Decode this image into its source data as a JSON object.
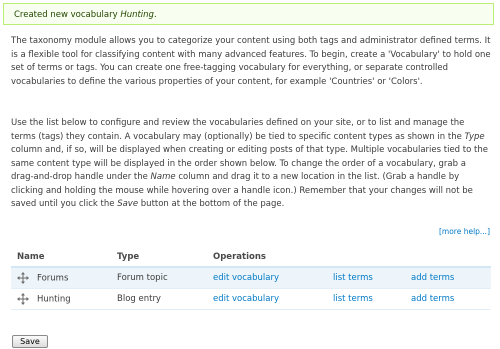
{
  "status_message": {
    "prefix": "Created new vocabulary ",
    "name": "Hunting",
    "suffix": "."
  },
  "help": {
    "paragraph1": "The taxonomy module allows you to categorize your content using both tags and administrator defined terms. It is a flexible tool for classifying content with many advanced features. To begin, create a 'Vocabulary' to hold one set of terms or tags. You can create one free-tagging vocabulary for everything, or separate controlled vocabularies to define the various properties of your content, for example 'Countries' or 'Colors'.",
    "p2_a": "Use the list below to configure and review the vocabularies defined on your site, or to list and manage the terms (tags) they contain. A vocabulary may (optionally) be tied to specific content types as shown in the ",
    "p2_type": "Type",
    "p2_b": " column and, if so, will be displayed when creating or editing posts of that type. Multiple vocabularies tied to the same content type will be displayed in the order shown below. To change the order of a vocabulary, grab a drag-and-drop handle under the ",
    "p2_name": "Name",
    "p2_c": " column and drag it to a new location in the list. (Grab a handle by clicking and holding the mouse while hovering over a handle icon.) Remember that your changes will not be saved until you click the ",
    "p2_save": "Save",
    "p2_d": " button at the bottom of the page.",
    "more_help": "[more help...]"
  },
  "table": {
    "headers": {
      "name": "Name",
      "type": "Type",
      "operations": "Operations"
    },
    "rows": [
      {
        "name": "Forums",
        "type": "Forum topic",
        "edit": "edit vocabulary",
        "list": "list terms",
        "add": "add terms"
      },
      {
        "name": "Hunting",
        "type": "Blog entry",
        "edit": "edit vocabulary",
        "list": "list terms",
        "add": "add terms"
      }
    ]
  },
  "save_button": "Save",
  "colors": {
    "link": "#027ac6",
    "status_bg": "#f8fff0",
    "status_border": "#bbee77",
    "row_highlight": "#edf5fa"
  },
  "icons": {
    "drag_handle": "drag-handle-icon"
  }
}
